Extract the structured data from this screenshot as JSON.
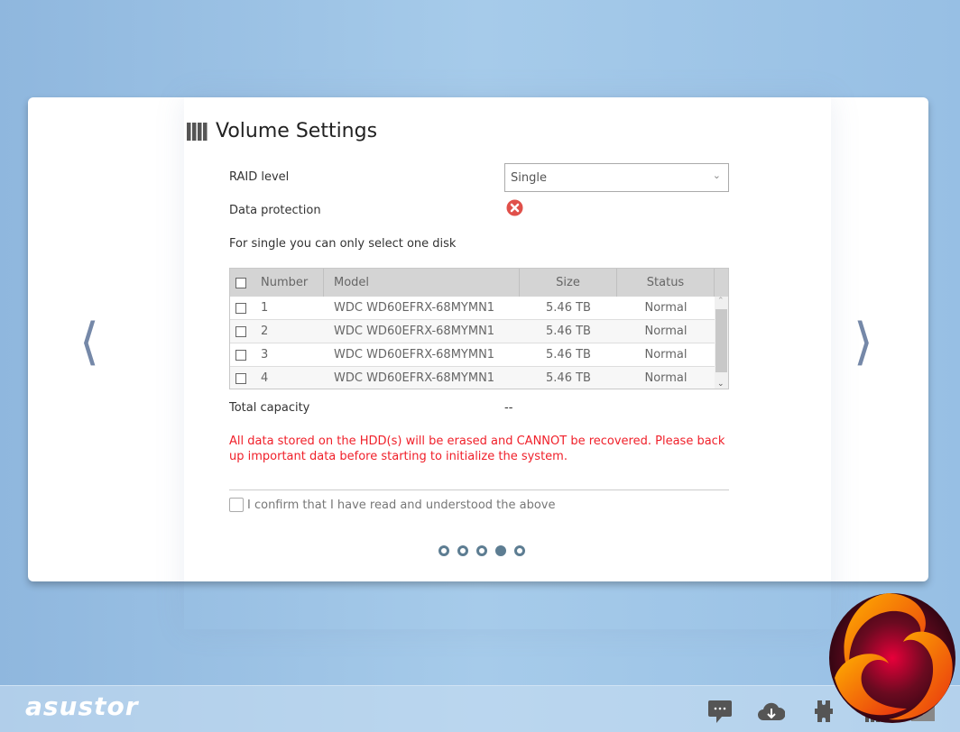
{
  "title": "Volume Settings",
  "raid": {
    "label": "RAID level",
    "value": "Single"
  },
  "protection": {
    "label": "Data protection"
  },
  "hint": "For single you can only select one disk",
  "table": {
    "headers": [
      "Number",
      "Model",
      "Size",
      "Status"
    ],
    "rows": [
      {
        "number": "1",
        "model": "WDC WD60EFRX-68MYMN1",
        "size": "5.46 TB",
        "status": "Normal"
      },
      {
        "number": "2",
        "model": "WDC WD60EFRX-68MYMN1",
        "size": "5.46 TB",
        "status": "Normal"
      },
      {
        "number": "3",
        "model": "WDC WD60EFRX-68MYMN1",
        "size": "5.46 TB",
        "status": "Normal"
      },
      {
        "number": "4",
        "model": "WDC WD60EFRX-68MYMN1",
        "size": "5.46 TB",
        "status": "Normal"
      }
    ]
  },
  "capacity": {
    "label": "Total capacity",
    "value": "--"
  },
  "warning": "All data stored on the HDD(s) will be erased and CANNOT be recovered. Please back up important data before starting to initialize the system.",
  "confirm": "I confirm that I have read and understood the above",
  "steps": {
    "total": 5,
    "current": 4
  },
  "brand": "asustor",
  "colors": {
    "warning": "#f0202a",
    "dot": "#5d7d92",
    "error": "#e0504a"
  }
}
